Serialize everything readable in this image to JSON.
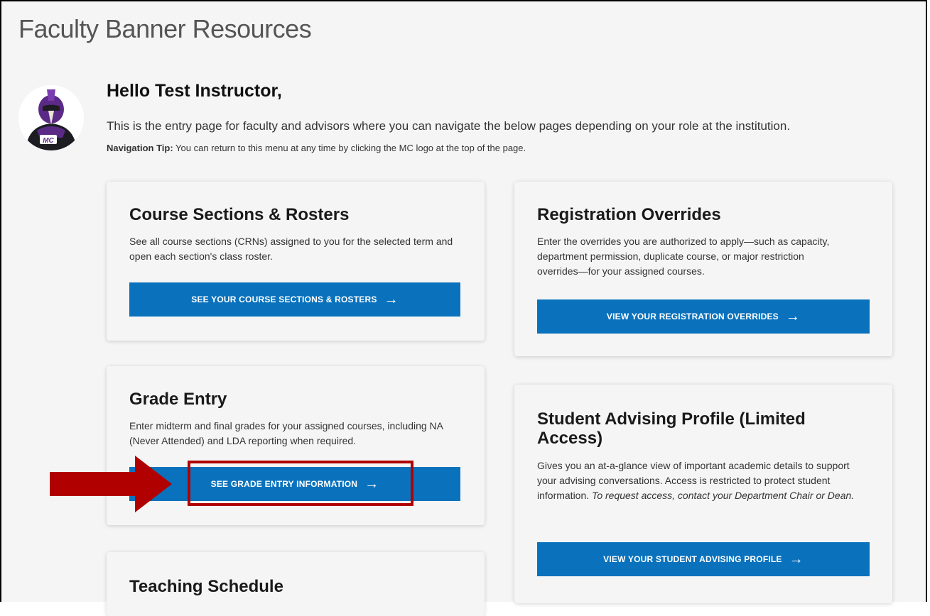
{
  "page": {
    "title": "Faculty Banner Resources"
  },
  "greeting": "Hello Test Instructor,",
  "intro": "This is the entry page for faculty and advisors where you can navigate the below pages depending on your role at the institution.",
  "tip": {
    "label": "Navigation Tip:",
    "text": "You can return to this menu at any time by clicking the MC logo at the top of the page."
  },
  "avatar": {
    "logo_text": "MC"
  },
  "cards": {
    "course_sections": {
      "title": "Course Sections & Rosters",
      "desc": "See all course sections (CRNs) assigned to you for the selected term and open each section's class roster.",
      "button": "See your course sections & rosters"
    },
    "registration_overrides": {
      "title": "Registration Overrides",
      "desc": "Enter the overrides you are authorized to apply—such as capacity, department permission, duplicate course, or major restriction overrides—for your assigned courses.",
      "button": "View your registration overrides"
    },
    "grade_entry": {
      "title": "Grade Entry",
      "desc": "Enter midterm and final grades for your assigned courses, including NA (Never Attended) and LDA reporting when required.",
      "button": "See grade entry information"
    },
    "student_advising": {
      "title": "Student Advising Profile (Limited Access)",
      "desc": "Gives you an at-a-glance view of important academic details to support your advising conversations. Access is restricted to protect student information.",
      "desc_italic": "To request access, contact your Department Chair or Dean.",
      "button": "View your student advising profile"
    },
    "teaching_schedule": {
      "title": "Teaching Schedule"
    }
  },
  "icons": {
    "button_arrow": "→",
    "annotation_arrow": "right-arrow-icon"
  },
  "colors": {
    "button": "#0a72bd",
    "annotation": "#b00000"
  }
}
